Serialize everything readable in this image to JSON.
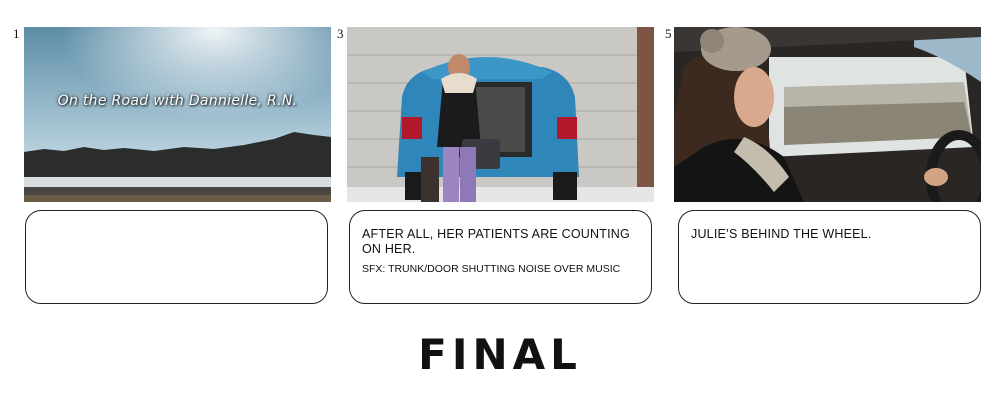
{
  "frames": [
    {
      "number": "1",
      "overlay_title": "On the Road with Dannielle, R.N.",
      "caption_vo": "",
      "caption_sfx": "",
      "scene": "snowy-landscape"
    },
    {
      "number": "3",
      "overlay_title": "",
      "caption_vo": "AFTER ALL, HER PATIENTS ARE COUNTING ON HER.",
      "caption_sfx": "SFX: TRUNK/DOOR SHUTTING NOISE OVER MUSIC",
      "scene": "woman-at-car-trunk"
    },
    {
      "number": "5",
      "overlay_title": "",
      "caption_vo": "JULIE’S BEHIND THE WHEEL.",
      "caption_sfx": "",
      "scene": "woman-driving"
    }
  ],
  "footer_label": "FINAL"
}
